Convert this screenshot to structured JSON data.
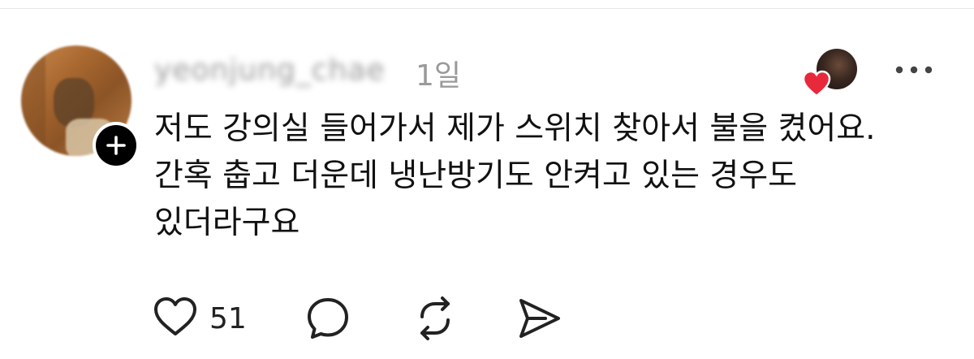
{
  "post": {
    "username": "yeonjung_chae",
    "timestamp": "1일",
    "comment_lines": [
      "저도 강의실 들어가서 제가 스위치 찾아서 불을 켰어요.",
      "간혹 춥고 더운데 냉난방기도 안켜고 있는 경우도",
      "있더라구요"
    ]
  },
  "actions": {
    "like_count": "51"
  },
  "icons": {
    "follow": "plus-icon",
    "liked_by": "heart-icon",
    "more": "more-horizontal-icon",
    "like": "heart-outline-icon",
    "reply": "speech-bubble-icon",
    "repost": "repost-icon",
    "share": "send-icon"
  },
  "colors": {
    "heart_red": "#e8283b",
    "muted_text": "#9a9a9a",
    "text": "#111111"
  }
}
